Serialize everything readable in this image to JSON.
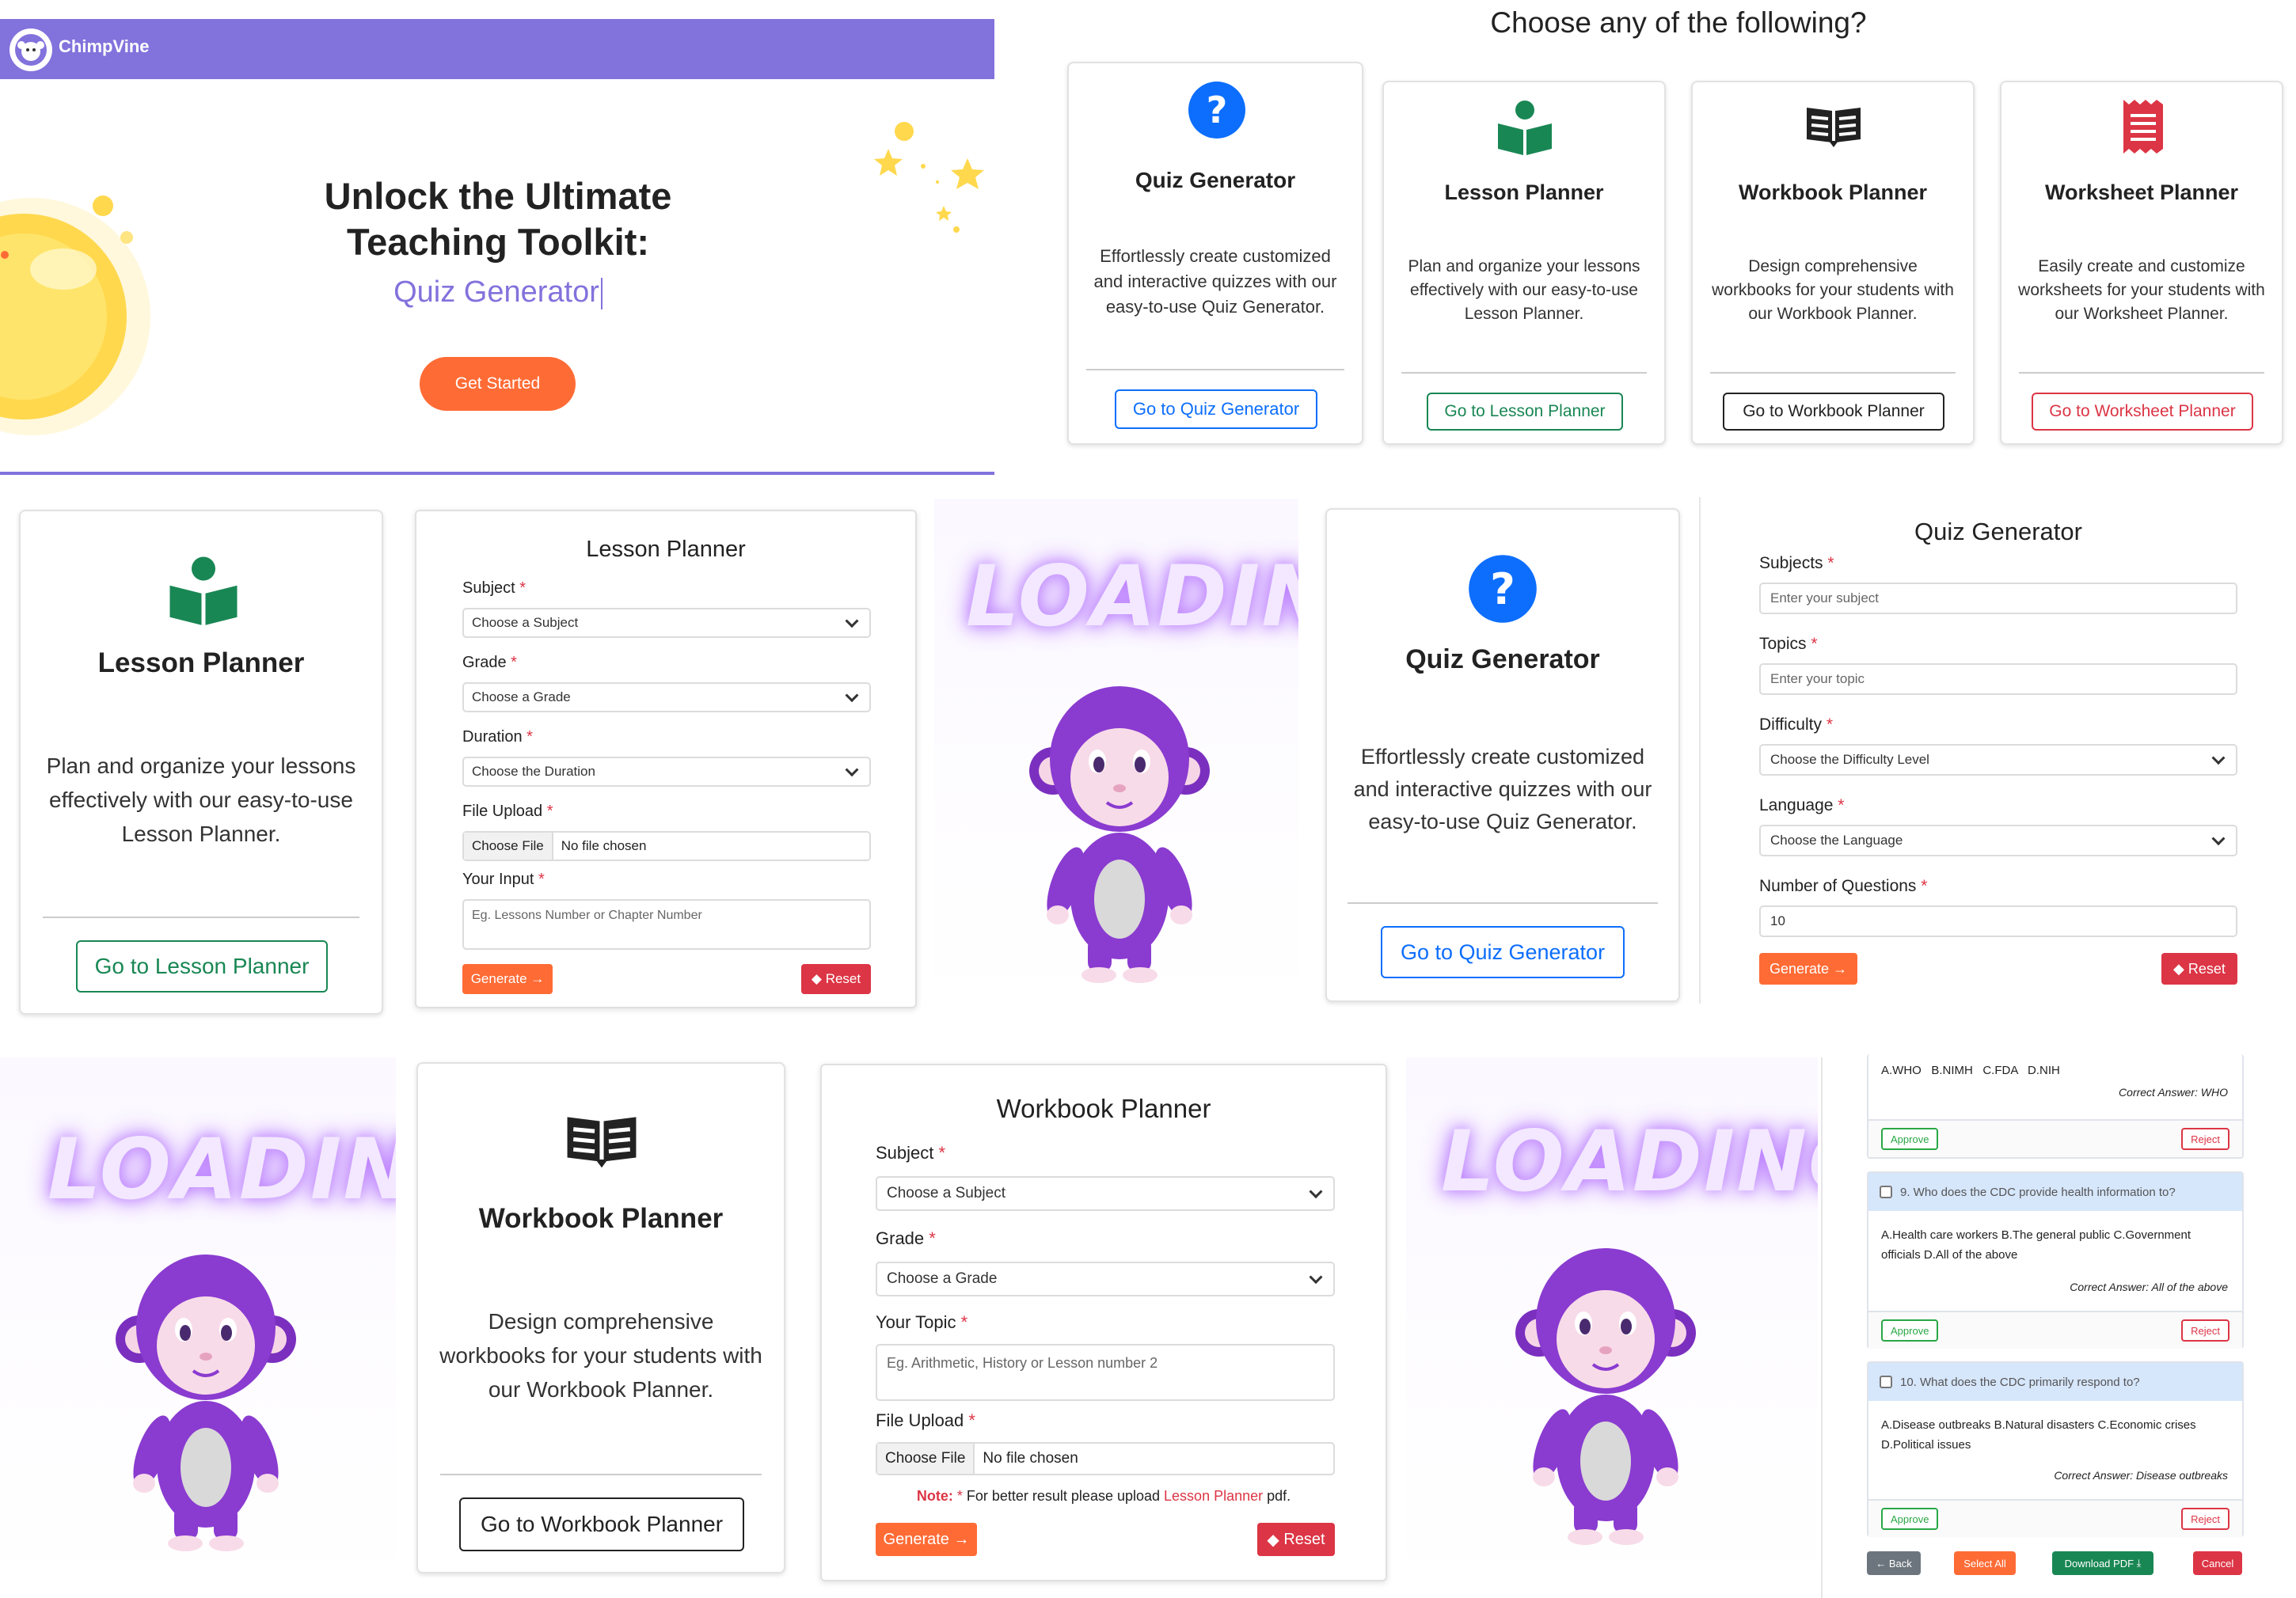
{
  "brand": {
    "name": "ChimpVine"
  },
  "hero": {
    "line1": "Unlock the Ultimate",
    "line2": "Teaching Toolkit:",
    "typed": "Quiz Generator",
    "cta": "Get Started"
  },
  "choose": {
    "heading": "Choose any of the following?",
    "cards": [
      {
        "title": "Quiz Generator",
        "desc": "Effortlessly create customized and interactive quizzes with our easy-to-use Quiz Generator.",
        "button": "Go to Quiz Generator",
        "icon": "question-circle-icon",
        "color": "#0d6efd"
      },
      {
        "title": "Lesson Planner",
        "desc": "Plan and organize your lessons effectively with our easy-to-use Lesson Planner.",
        "button": "Go to Lesson Planner",
        "icon": "reading-person-icon",
        "color": "#198754"
      },
      {
        "title": "Workbook Planner",
        "desc": "Design comprehensive workbooks for your students with our Workbook Planner.",
        "button": "Go to Workbook Planner",
        "icon": "open-book-icon",
        "color": "#222222"
      },
      {
        "title": "Worksheet Planner",
        "desc": "Easily create and customize worksheets for your students with our Worksheet Planner.",
        "button": "Go to Worksheet Planner",
        "icon": "receipt-icon",
        "color": "#dc3545"
      }
    ]
  },
  "lesson_card": {
    "title": "Lesson Planner",
    "desc": "Plan and organize your lessons effectively with our easy-to-use Lesson Planner.",
    "button": "Go to Lesson Planner"
  },
  "lesson_form": {
    "title": "Lesson Planner",
    "subject_label": "Subject",
    "subject_value": "Choose a Subject",
    "grade_label": "Grade",
    "grade_value": "Choose a Grade",
    "duration_label": "Duration",
    "duration_value": "Choose the Duration",
    "file_label": "File Upload",
    "file_button": "Choose File",
    "file_name": "No file chosen",
    "input_label": "Your Input",
    "input_placeholder": "Eg. Lessons Number or Chapter Number",
    "generate": "Generate",
    "reset": "Reset"
  },
  "loading_text": "LOADING!",
  "quiz_card": {
    "title": "Quiz Generator",
    "desc": "Effortlessly create customized and interactive quizzes with our easy-to-use Quiz Generator.",
    "button": "Go to Quiz Generator"
  },
  "quiz_form": {
    "title": "Quiz Generator",
    "subjects_label": "Subjects",
    "subjects_placeholder": "Enter your subject",
    "topics_label": "Topics",
    "topics_placeholder": "Enter your topic",
    "difficulty_label": "Difficulty",
    "difficulty_value": "Choose the Difficulty Level",
    "language_label": "Language",
    "language_value": "Choose the Language",
    "num_label": "Number of Questions",
    "num_value": "10",
    "generate": "Generate",
    "reset": "Reset"
  },
  "workbook_card": {
    "title": "Workbook Planner",
    "desc": "Design comprehensive workbooks for your students with our Workbook Planner.",
    "button": "Go to Workbook Planner"
  },
  "workbook_form": {
    "title": "Workbook Planner",
    "subject_label": "Subject",
    "subject_value": "Choose a Subject",
    "grade_label": "Grade",
    "grade_value": "Choose a Grade",
    "topic_label": "Your Topic",
    "topic_placeholder": "Eg. Arithmetic, History or Lesson number 2",
    "file_label": "File Upload",
    "file_button": "Choose File",
    "file_name": "No file chosen",
    "note_prefix": "Note:",
    "note_text": " For better result please upload ",
    "note_link": "Lesson Planner",
    "note_suffix": " pdf.",
    "generate": "Generate",
    "reset": "Reset"
  },
  "quiz_results": {
    "q8": {
      "options": "A.WHO   B.NIMH   C.FDA   D.NIH",
      "answer": "Correct Answer: WHO"
    },
    "q9": {
      "question": "9. Who does the CDC provide health information to?",
      "options": "A.Health care workers  B.The general public  C.Government officials  D.All of the above",
      "answer": "Correct Answer: All of the above"
    },
    "q10": {
      "question": "10. What does the CDC primarily respond to?",
      "options": "A.Disease outbreaks  B.Natural disasters  C.Economic crises  D.Political issues",
      "answer": "Correct Answer: Disease outbreaks"
    },
    "approve": "Approve",
    "reject": "Reject",
    "back": "Back",
    "select_all": "Select All",
    "download": "Download PDF",
    "cancel": "Cancel"
  }
}
